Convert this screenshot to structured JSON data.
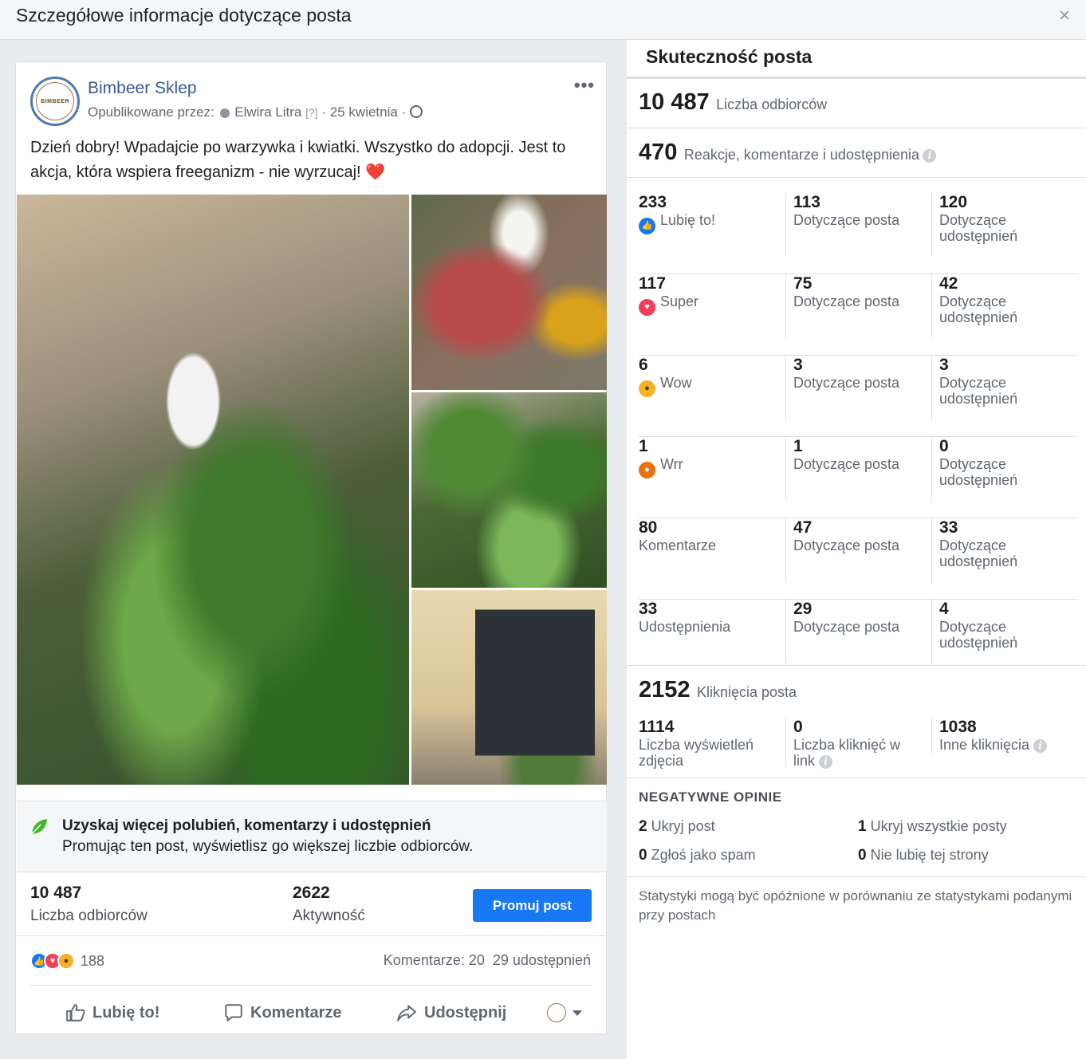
{
  "dialog": {
    "title": "Szczegółowe informacje dotyczące posta",
    "close": "×"
  },
  "post": {
    "page_name": "Bimbeer Sklep",
    "avatar_text": "BIMBEER",
    "published_by_label": "Opublikowane przez:",
    "author": "Elwira Litra",
    "author_help": "[?]",
    "date": "25 kwietnia",
    "text": "Dzień dobry! Wpadajcie po warzywka i kwiatki. Wszystko do adopcji. Jest to akcja, która wspiera freeganizm - nie wyrzucaj!",
    "text_emoji": "❤️",
    "more_menu": "•••",
    "promo": {
      "title": "Uzyskaj więcej polubień, komentarzy i udostępnień",
      "subtitle": "Promując ten post, wyświetlisz go większej liczbie odbiorców."
    },
    "stats": {
      "reach_value": "10 487",
      "reach_label": "Liczba odbiorców",
      "activity_value": "2622",
      "activity_label": "Aktywność"
    },
    "promote_button": "Promuj post",
    "reaction_count": "188",
    "comments_count": "Komentarze: 20",
    "shares_count": "29 udostępnień",
    "actions": {
      "like": "Lubię to!",
      "comment": "Komentarze",
      "share": "Udostępnij"
    }
  },
  "performance": {
    "title": "Skuteczność posta",
    "reach_value": "10 487",
    "reach_label": "Liczba odbiorców",
    "engagement_value": "470",
    "engagement_label": "Reakcje, komentarze i udostępnienia",
    "rows": [
      {
        "total": "233",
        "label": "Lubię to!",
        "icon": "like-reaction-icon",
        "on_post": "113",
        "on_post_label": "Dotyczące posta",
        "on_shares": "120",
        "on_shares_label": "Dotyczące udostępnień"
      },
      {
        "total": "117",
        "label": "Super",
        "icon": "love-reaction-icon",
        "on_post": "75",
        "on_post_label": "Dotyczące posta",
        "on_shares": "42",
        "on_shares_label": "Dotyczące udostępnień"
      },
      {
        "total": "6",
        "label": "Wow",
        "icon": "wow-reaction-icon",
        "on_post": "3",
        "on_post_label": "Dotyczące posta",
        "on_shares": "3",
        "on_shares_label": "Dotyczące udostępnień"
      },
      {
        "total": "1",
        "label": "Wrr",
        "icon": "angry-reaction-icon",
        "on_post": "1",
        "on_post_label": "Dotyczące posta",
        "on_shares": "0",
        "on_shares_label": "Dotyczące udostępnień"
      },
      {
        "total": "80",
        "label": "Komentarze",
        "icon": "",
        "on_post": "47",
        "on_post_label": "Dotyczące posta",
        "on_shares": "33",
        "on_shares_label": "Dotyczące udostępnień"
      },
      {
        "total": "33",
        "label": "Udostępnienia",
        "icon": "",
        "on_post": "29",
        "on_post_label": "Dotyczące posta",
        "on_shares": "4",
        "on_shares_label": "Dotyczące udostępnień"
      }
    ],
    "clicks_value": "2152",
    "clicks_label": "Kliknięcia posta",
    "clicks": {
      "photo_views": "1114",
      "photo_views_label": "Liczba wyświetleń zdjęcia",
      "link_clicks": "0",
      "link_clicks_label": "Liczba kliknięć w link",
      "other_clicks": "1038",
      "other_clicks_label": "Inne kliknięcia"
    },
    "negative": {
      "title": "NEGATYWNE OPINIE",
      "hide_post_value": "2",
      "hide_post_label": "Ukryj post",
      "hide_all_value": "1",
      "hide_all_label": "Ukryj wszystkie posty",
      "spam_value": "0",
      "spam_label": "Zgłoś jako spam",
      "unlike_value": "0",
      "unlike_label": "Nie lubię tej strony"
    },
    "footnote": "Statystyki mogą być opóźnione w porównaniu ze statystykami podanymi przy postach"
  },
  "colors": {
    "brand_blue": "#1877f2",
    "link_blue": "#385898",
    "love_red": "#f33e58",
    "wow_yellow": "#f7b125",
    "angry_orange": "#e9710f"
  }
}
